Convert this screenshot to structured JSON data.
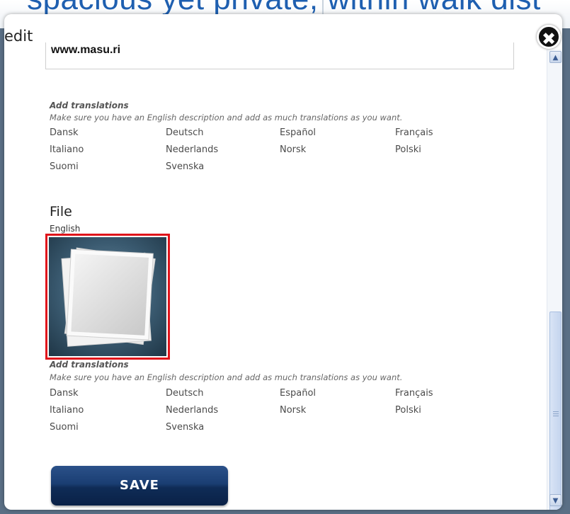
{
  "background": {
    "partial_text": "spacious yet private, within walk dist"
  },
  "modal": {
    "title": "edit",
    "close_icon": "close-icon"
  },
  "url_field": {
    "value": "www.masu.ri"
  },
  "translations_top": {
    "heading": "Add translations",
    "hint": "Make sure you have an English description and add as much translations as you want.",
    "languages": [
      "Dansk",
      "Deutsch",
      "Español",
      "Français",
      "Italiano",
      "Nederlands",
      "Norsk",
      "Polski",
      "Suomi",
      "Svenska"
    ]
  },
  "file": {
    "heading": "File",
    "language": "English",
    "thumbnail_icon": "image-placeholder-icon"
  },
  "translations_bottom": {
    "heading": "Add translations",
    "hint": "Make sure you have an English description and add as much translations as you want.",
    "languages": [
      "Dansk",
      "Deutsch",
      "Español",
      "Français",
      "Italiano",
      "Nederlands",
      "Norsk",
      "Polski",
      "Suomi",
      "Svenska"
    ]
  },
  "save_button": {
    "label": "SAVE"
  },
  "scrollbar": {
    "up_icon": "chevron-up-icon",
    "down_icon": "chevron-down-icon",
    "position": 0.86
  },
  "colors": {
    "accent": "#1a3e73",
    "highlight_border": "#e0141b",
    "background_link": "#1e5fb0"
  }
}
